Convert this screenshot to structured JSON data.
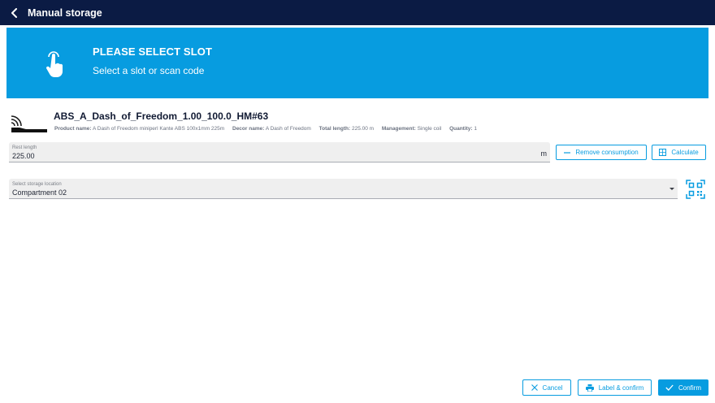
{
  "header": {
    "title": "Manual storage"
  },
  "banner": {
    "heading": "PLEASE SELECT SLOT",
    "subheading": "Select a slot or scan code"
  },
  "product": {
    "name": "ABS_A_Dash_of_Freedom_1.00_100.0_HM#63",
    "details": [
      {
        "label": "Product name:",
        "value": "A Dash of Freedom miniperl Kante ABS 100x1mm 225m"
      },
      {
        "label": "Decor name:",
        "value": "A Dash of Freedom"
      },
      {
        "label": "Total length:",
        "value": "225.00 m"
      },
      {
        "label": "Management:",
        "value": "Single coil"
      },
      {
        "label": "Quantity:",
        "value": "1"
      }
    ]
  },
  "rest_length": {
    "label": "Rest length",
    "value": "225.00",
    "unit": "m"
  },
  "buttons": {
    "remove_consumption": "Remove consumption",
    "calculate": "Calculate",
    "cancel": "Cancel",
    "label_confirm": "Label & confirm",
    "confirm": "Confirm"
  },
  "storage_location": {
    "label": "Select storage location",
    "value": "Compartment 02"
  },
  "colors": {
    "navy": "#0b1b44",
    "accent": "#079ce0"
  }
}
